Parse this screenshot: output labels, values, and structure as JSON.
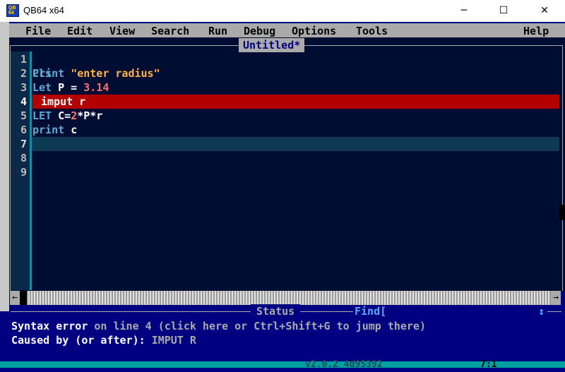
{
  "window": {
    "title": "QB64 x64",
    "icon_text": "QB 64",
    "minimize": "─",
    "maximize": "☐",
    "close": "✕"
  },
  "menu": {
    "file": "File",
    "edit": "Edit",
    "view": "View",
    "search": "Search",
    "run": "Run",
    "debug": "Debug",
    "options": "Options",
    "tools": "Tools",
    "help": "Help"
  },
  "editor": {
    "filename": "Untitled*",
    "line_numbers": [
      "1",
      "2",
      "3",
      "4",
      "5",
      "6",
      "7",
      "8",
      "9"
    ],
    "lines": {
      "l1": {
        "kw": "Cls"
      },
      "l2": {
        "kw": "Print ",
        "str": "\"enter radius\""
      },
      "l3": {
        "kw": "Let ",
        "text": "P = ",
        "num": "3.14"
      },
      "l4": {
        "text": "imput r"
      },
      "l5": {
        "kw": "LET ",
        "a": "C=",
        "num": "2",
        "b": "*P*r"
      },
      "l6": {
        "kw": "print ",
        "text": "c"
      }
    },
    "error_line": 4,
    "cursor_line": 7
  },
  "scrollbar": {
    "left_arrow": "←",
    "right_arrow": "→"
  },
  "status": {
    "title": "Status",
    "find_label": "Find[",
    "find_arrow": "↕",
    "msg1_a": "Syntax error",
    "msg1_b": " on line 4 (click here or Ctrl+Shift+G to jump there)",
    "msg2_a": "Caused by (or after): ",
    "msg2_b": "IMPUT R"
  },
  "bottom": {
    "version": "v2.0.2 4d95392",
    "position": "7:1"
  },
  "colors": {
    "background": "#000080",
    "editor_bg": "#000d33",
    "error_line": "#b30000",
    "keyword": "#5fa8d3",
    "string": "#ffb347",
    "number": "#ff7070"
  }
}
